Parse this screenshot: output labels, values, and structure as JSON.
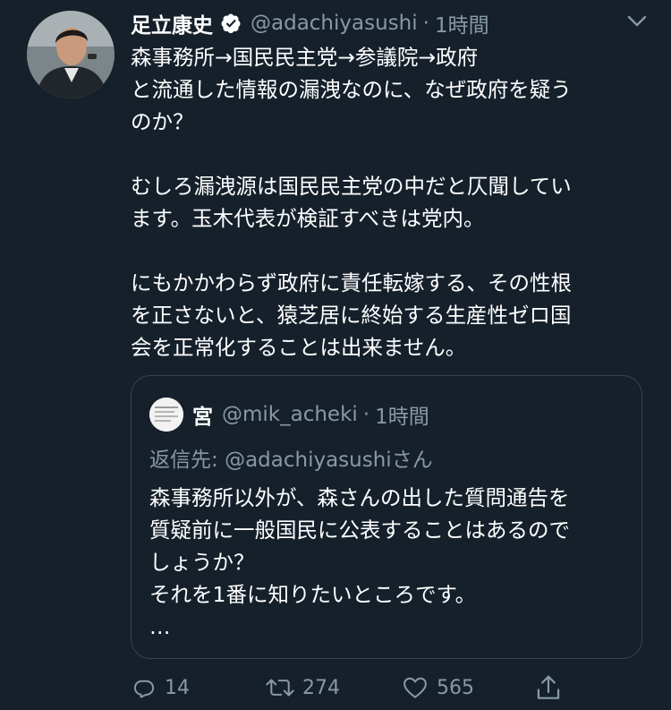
{
  "tweet": {
    "author_name": "足立康史",
    "verified_icon": "verified-badge-icon",
    "handle": "@adachiyasushi",
    "separator": "·",
    "time": "1時間",
    "lines": [
      "森事務所→国民民主党→参議院→政府",
      "と流通した情報の漏洩なのに、なぜ政府を疑う",
      "のか？",
      "",
      "むしろ漏洩源は国民民主党の中だと仄聞してい",
      "ます。玉木代表が検証すべきは党内。",
      "",
      "にもかかわらず政府に責任転嫁する、その性根",
      "を正さないと、猿芝居に終始する生産性ゼロ国",
      "会を正常化することは出来ません。"
    ]
  },
  "quoted_tweet": {
    "author_name": "宮",
    "handle": "@mik_acheki",
    "separator": "·",
    "time": "1時間",
    "reply_prefix": "返信先: ",
    "reply_handle": "@adachiyasushi",
    "reply_suffix": "さん",
    "lines": [
      "森事務所以外が、森さんの出した質問通告を",
      "質疑前に一般国民に公表することはあるので",
      "しょうか？",
      "それを1番に知りたいところです。",
      "…"
    ]
  },
  "actions": {
    "reply_count": "14",
    "retweet_count": "274",
    "like_count": "565"
  },
  "colors": {
    "background": "#15202b",
    "secondary_text": "#8899a6",
    "border": "#38444d",
    "primary_text": "#ffffff"
  }
}
